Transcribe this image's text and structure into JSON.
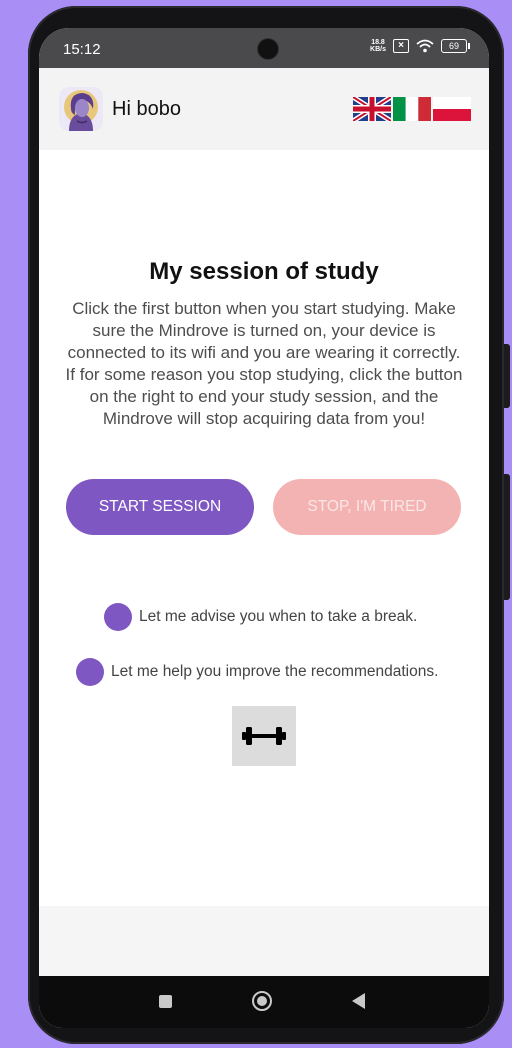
{
  "status_bar": {
    "time": "15:12",
    "net_speed_value": "18.8",
    "net_speed_unit": "KB/s",
    "battery": "69",
    "icons": [
      "camera-cutout",
      "no-sim-icon",
      "wifi-icon",
      "battery-icon"
    ]
  },
  "header": {
    "greeting": "Hi bobo",
    "avatar": "avatar-woman-icon",
    "languages": [
      "english-flag",
      "italian-flag",
      "polish-flag"
    ]
  },
  "main": {
    "title": "My session of study",
    "description": "Click the first button when you start studying. Make sure the Mindrove is turned on, your device is connected to its wifi and you are wearing it correctly. If for some reason you stop studying, click the button on the right to end your study session, and the Mindrove will stop acquiring data from you!",
    "start_button": "START SESSION",
    "stop_button": "STOP, I'M TIRED",
    "options": [
      {
        "label": "Let me advise you when to take a break."
      },
      {
        "label": "Let me help you improve the recommendations."
      }
    ],
    "gym_icon": "dumbbell-icon"
  },
  "colors": {
    "accent": "#7e57c2",
    "stop_button": "#f4b3b3",
    "background": "#a98ef6"
  },
  "nav": [
    "recent-apps-icon",
    "home-icon",
    "back-icon"
  ]
}
